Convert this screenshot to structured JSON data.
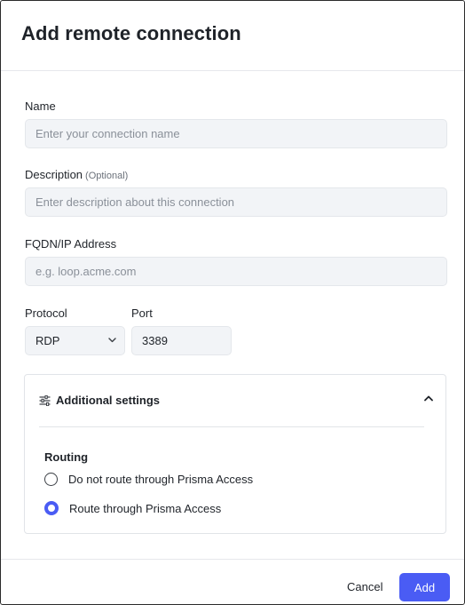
{
  "dialog": {
    "title": "Add remote connection"
  },
  "form": {
    "name": {
      "label": "Name",
      "placeholder": "Enter your connection name"
    },
    "description": {
      "label": "Description",
      "optional": "(Optional)",
      "placeholder": "Enter description about this connection"
    },
    "fqdn": {
      "label": "FQDN/IP Address",
      "placeholder": "e.g. loop.acme.com"
    },
    "protocol": {
      "label": "Protocol",
      "value": "RDP"
    },
    "port": {
      "label": "Port",
      "value": "3389"
    }
  },
  "additional_settings": {
    "title": "Additional settings",
    "routing_label": "Routing",
    "options": [
      {
        "label": "Do not route through Prisma Access",
        "selected": false
      },
      {
        "label": "Route through Prisma Access",
        "selected": true
      }
    ]
  },
  "footer": {
    "cancel": "Cancel",
    "add": "Add"
  },
  "colors": {
    "accent": "#4a5cf4",
    "input_bg": "#f2f4f7"
  },
  "icons": {
    "settings": "sliders-icon",
    "collapse": "chevron-up-icon",
    "select": "chevron-down-icon"
  }
}
